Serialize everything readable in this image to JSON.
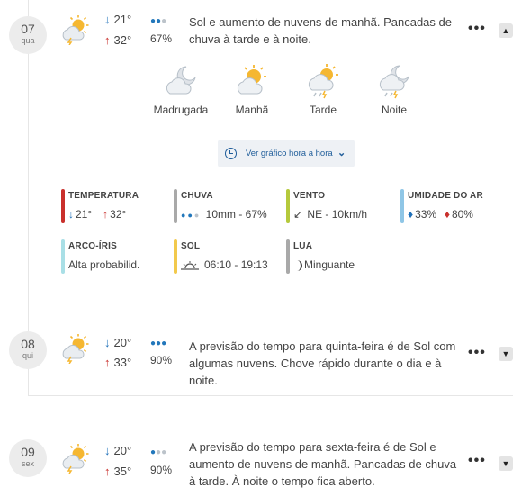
{
  "days": [
    {
      "day": "07",
      "weekday": "qua",
      "min": "21°",
      "max": "32°",
      "drops": [
        "blue",
        "blue",
        "grey"
      ],
      "precip": "67%",
      "description": "Sol e aumento de nuvens de manhã. Pancadas de chuva à tarde e à noite.",
      "icon": "sun-cloud-lightning-icon",
      "more_label": "•••",
      "toggle": "▲"
    },
    {
      "day": "08",
      "weekday": "qui",
      "min": "20°",
      "max": "33°",
      "drops": [
        "blue",
        "blue",
        "blue"
      ],
      "precip": "90%",
      "description": "A previsão do tempo para quinta-feira é de Sol com algumas nuvens. Chove rápido durante o dia e à noite.",
      "icon": "sun-cloud-lightning-icon",
      "more_label": "•••",
      "toggle": "▼"
    },
    {
      "day": "09",
      "weekday": "sex",
      "min": "20°",
      "max": "35°",
      "drops": [
        "blue",
        "grey",
        "grey"
      ],
      "precip": "90%",
      "description": "A previsão do tempo para sexta-feira é de Sol e aumento de nuvens de manhã. Pancadas de chuva à tarde. À noite o tempo fica aberto.",
      "icon": "sun-cloud-lightning-icon",
      "more_label": "•••",
      "toggle": "▼"
    }
  ],
  "periods": [
    {
      "label": "Madrugada",
      "icon": "moon-cloud-icon"
    },
    {
      "label": "Manhã",
      "icon": "sun-cloud-icon"
    },
    {
      "label": "Tarde",
      "icon": "sun-cloud-rain-icon"
    },
    {
      "label": "Noite",
      "icon": "moon-cloud-rain-icon"
    }
  ],
  "hourly_button": {
    "label": "Ver gráfico hora a hora",
    "chevron": "⌄"
  },
  "details": {
    "temperature": {
      "title": "TEMPERATURA",
      "min": "21°",
      "max": "32°",
      "color": "#c9302c"
    },
    "rain": {
      "title": "CHUVA",
      "value": "10mm - 67%",
      "color": "#a9a9a9"
    },
    "wind": {
      "title": "VENTO",
      "value": "NE - 10km/h",
      "arrow": "↙",
      "color": "#b5c93c"
    },
    "humidity": {
      "title": "UMIDADE DO AR",
      "min": "33%",
      "max": "80%",
      "color": "#8fc6e6"
    },
    "rainbow": {
      "title": "ARCO-ÍRIS",
      "value": "Alta probabilid.",
      "color": "#a9dfe6"
    },
    "sun": {
      "title": "SOL",
      "value": "06:10 - 19:13",
      "color": "#f2c94c"
    },
    "moon": {
      "title": "LUA",
      "value": "Minguante",
      "color": "#a9a9a9"
    }
  },
  "colors": {
    "accent_blue": "#1e6fb8",
    "accent_red": "#c9302c",
    "sun_yellow": "#f5b731"
  }
}
